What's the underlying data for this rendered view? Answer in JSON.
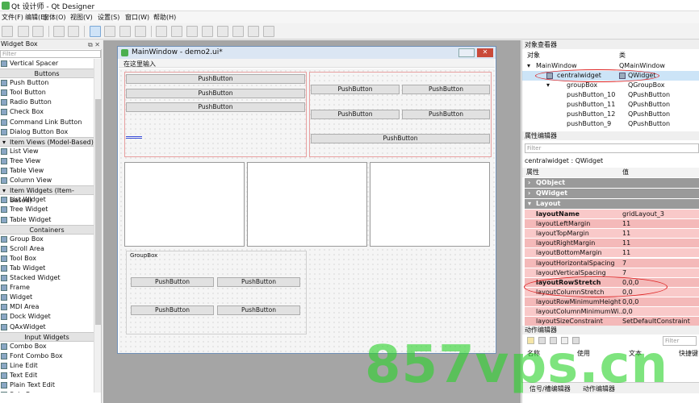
{
  "app": {
    "title": "Qt 设计师 - Qt Designer"
  },
  "menu": [
    "文件(F)",
    "编辑(E)",
    "窗体(O)",
    "视图(V)",
    "设置(S)",
    "窗口(W)",
    "帮助(H)"
  ],
  "widget_box": {
    "title": "Widget Box",
    "filter_placeholder": "Filter",
    "rows": [
      {
        "kind": "item",
        "label": "Vertical Spacer"
      },
      {
        "kind": "cat",
        "label": "Buttons"
      },
      {
        "kind": "item",
        "label": "Push Button"
      },
      {
        "kind": "item",
        "label": "Tool Button"
      },
      {
        "kind": "item",
        "label": "Radio Button"
      },
      {
        "kind": "item",
        "label": "Check Box"
      },
      {
        "kind": "item",
        "label": "Command Link Button"
      },
      {
        "kind": "item",
        "label": "Dialog Button Box"
      },
      {
        "kind": "cat",
        "label": "Item Views (Model-Based)"
      },
      {
        "kind": "item",
        "label": "List View"
      },
      {
        "kind": "item",
        "label": "Tree View"
      },
      {
        "kind": "item",
        "label": "Table View"
      },
      {
        "kind": "item",
        "label": "Column View"
      },
      {
        "kind": "cat",
        "label": "Item Widgets (Item-Based)"
      },
      {
        "kind": "item",
        "label": "List Widget"
      },
      {
        "kind": "item",
        "label": "Tree Widget"
      },
      {
        "kind": "item",
        "label": "Table Widget"
      },
      {
        "kind": "cat",
        "label": "Containers"
      },
      {
        "kind": "item",
        "label": "Group Box"
      },
      {
        "kind": "item",
        "label": "Scroll Area"
      },
      {
        "kind": "item",
        "label": "Tool Box"
      },
      {
        "kind": "item",
        "label": "Tab Widget"
      },
      {
        "kind": "item",
        "label": "Stacked Widget"
      },
      {
        "kind": "item",
        "label": "Frame"
      },
      {
        "kind": "item",
        "label": "Widget"
      },
      {
        "kind": "item",
        "label": "MDI Area"
      },
      {
        "kind": "item",
        "label": "Dock Widget"
      },
      {
        "kind": "item",
        "label": "QAxWidget"
      },
      {
        "kind": "cat",
        "label": "Input Widgets"
      },
      {
        "kind": "item",
        "label": "Combo Box"
      },
      {
        "kind": "item",
        "label": "Font Combo Box"
      },
      {
        "kind": "item",
        "label": "Line Edit"
      },
      {
        "kind": "item",
        "label": "Text Edit"
      },
      {
        "kind": "item",
        "label": "Plain Text Edit"
      },
      {
        "kind": "item",
        "label": "Spin Box"
      }
    ]
  },
  "form_window": {
    "title": "MainWindow - demo2.ui*",
    "menu_placeholder": "在这里输入",
    "push_button_label": "PushButton",
    "group_box_title": "GroupBox"
  },
  "object_inspector": {
    "title": "对象查看器",
    "col_object": "对象",
    "col_class": "类",
    "rows": [
      {
        "name": "MainWindow",
        "cls": "QMainWindow"
      },
      {
        "name": "centralwidget",
        "cls": "QWidget"
      },
      {
        "name": "groupBox",
        "cls": "QGroupBox"
      },
      {
        "name": "pushButton_10",
        "cls": "QPushButton"
      },
      {
        "name": "pushButton_11",
        "cls": "QPushButton"
      },
      {
        "name": "pushButton_12",
        "cls": "QPushButton"
      },
      {
        "name": "pushButton_9",
        "cls": "QPushButton"
      }
    ]
  },
  "property_editor": {
    "title": "属性编辑器",
    "filter_placeholder": "Filter",
    "context": "centralwidget : QWidget",
    "col_property": "属性",
    "col_value": "值",
    "categories": [
      "QObject",
      "QWidget",
      "Layout"
    ],
    "rows": [
      {
        "name": "layoutName",
        "value": "gridLayout_3",
        "bold": true
      },
      {
        "name": "layoutLeftMargin",
        "value": "11"
      },
      {
        "name": "layoutTopMargin",
        "value": "11"
      },
      {
        "name": "layoutRightMargin",
        "value": "11"
      },
      {
        "name": "layoutBottomMargin",
        "value": "11"
      },
      {
        "name": "layoutHorizontalSpacing",
        "value": "7"
      },
      {
        "name": "layoutVerticalSpacing",
        "value": "7"
      },
      {
        "name": "layoutRowStretch",
        "value": "0,0,0",
        "bold": true
      },
      {
        "name": "layoutColumnStretch",
        "value": "0,0"
      },
      {
        "name": "layoutRowMinimumHeight",
        "value": "0,0,0"
      },
      {
        "name": "layoutColumnMinimumWi...",
        "value": "0,0"
      },
      {
        "name": "layoutSizeConstraint",
        "value": "SetDefaultConstraint"
      }
    ]
  },
  "action_editor": {
    "title": "动作编辑器",
    "filter_placeholder": "Filter",
    "columns": [
      "名称",
      "使用",
      "文本",
      "快捷键"
    ]
  },
  "bottom_tabs": [
    "信号/槽编辑器",
    "动作编辑器"
  ],
  "watermark": "857vps.cn"
}
